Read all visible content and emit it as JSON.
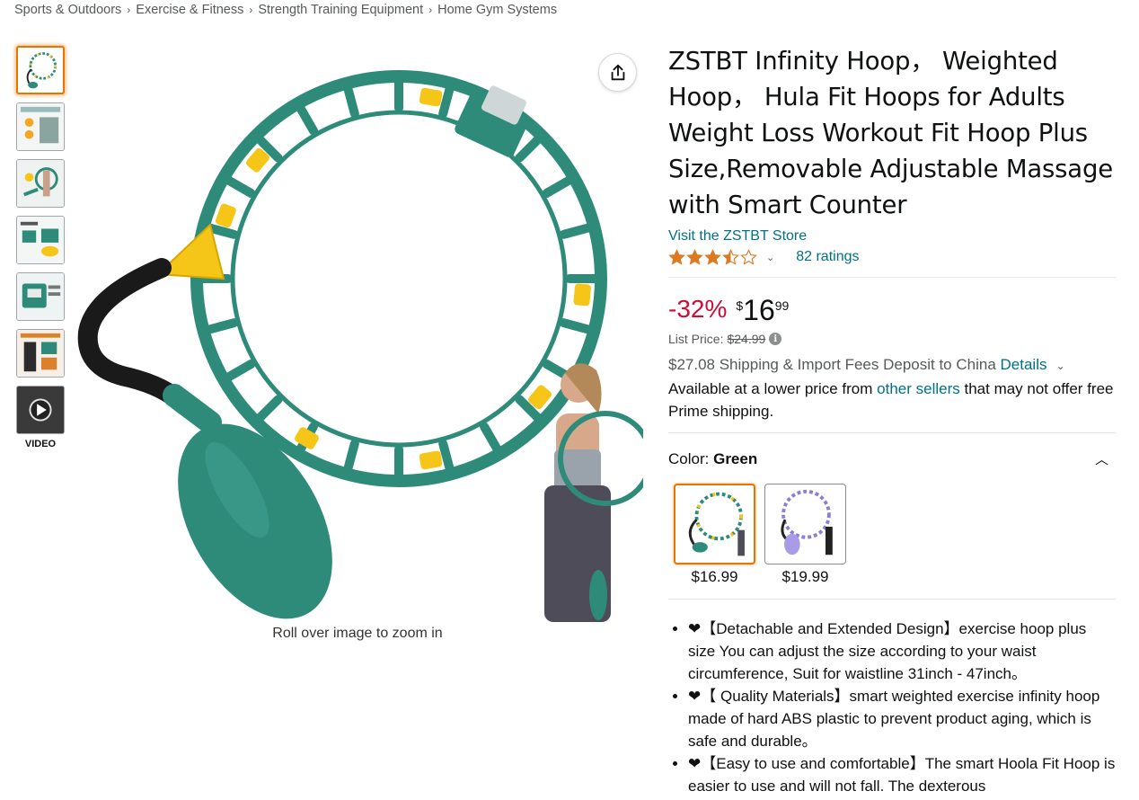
{
  "breadcrumb": [
    "Sports & Outdoors",
    "Exercise & Fitness",
    "Strength Training Equipment",
    "Home Gym Systems"
  ],
  "breadcrumb_separator": "›",
  "thumbnails": {
    "video_label": "VIDEO"
  },
  "zoom_hint": "Roll over image to zoom in",
  "product": {
    "title": "ZSTBT Infinity Hoop， Weighted Hoop， Hula Fit Hoops for Adults Weight Loss Workout Fit Hoop Plus Size,Removable Adjustable Massage with Smart Counter",
    "store_link": "Visit the ZSTBT Store",
    "rating_stars": 3.5,
    "ratings_count": "82 ratings",
    "discount": "-32%",
    "price_symbol": "$",
    "price_whole": "16",
    "price_fraction": "99",
    "list_price_label": "List Price:",
    "list_price": "$24.99",
    "shipping_text": "$27.08 Shipping & Import Fees Deposit to China",
    "shipping_details_link": "Details",
    "availability_prefix": "Available at a lower price from",
    "availability_link": "other sellers",
    "availability_suffix": "that may not offer free Prime shipping.",
    "color_label": "Color:",
    "color_value": "Green",
    "swatches": [
      {
        "price": "$16.99",
        "color": "green"
      },
      {
        "price": "$19.99",
        "color": "purple"
      }
    ],
    "bullets": [
      "❤【Detachable and Extended Design】exercise hoop plus size You can adjust the size according to your waist circumference, Suit for waistline 31inch - 47inch。",
      "❤【 Quality Materials】smart weighted exercise infinity hoop made of hard ABS plastic to prevent product aging, which is safe and durable。",
      "❤【Easy to use and comfortable】The smart Hoola Fit Hoop is easier to use and will not fall. The dexterous"
    ]
  },
  "colors": {
    "link": "#007185",
    "deal": "#cc0c39",
    "star": "#de7921",
    "selected_border": "#e77600",
    "hoop": "#2e8b7a",
    "accent_yellow": "#f5c518"
  }
}
